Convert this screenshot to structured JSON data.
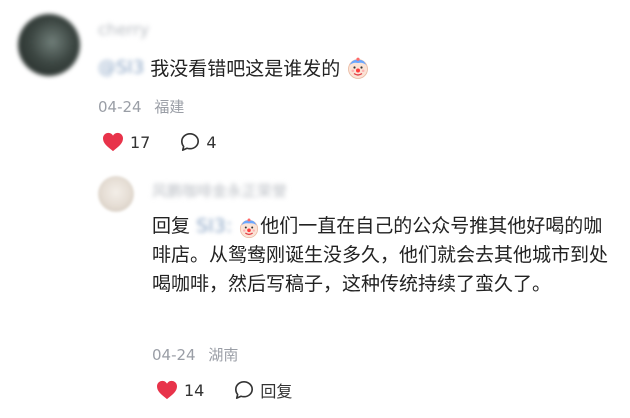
{
  "comment": {
    "username": "cherry",
    "mention": "@SI3",
    "text": "我没看错吧这是谁发的",
    "emoji": "clown-face-emoji",
    "date": "04-24",
    "location": "福建",
    "likes": "17",
    "replies": "4"
  },
  "reply": {
    "username": "风鹏咖啡金永正荣誉",
    "prefix": "回复",
    "mention": "SI3:",
    "text": "他们一直在自己的公众号推其他好喝的咖啡店。从鸳鸯刚诞生没多久，他们就会去其他城市到处喝咖啡，然后写稿子，这种传统持续了蛮久了。",
    "emoji": "clown-face-emoji",
    "date": "04-24",
    "location": "湖南",
    "likes": "14",
    "reply_label": "回复"
  },
  "colors": {
    "heart": "#e8334a",
    "meta": "#9a9ea6",
    "mention": "#8aa4c4"
  }
}
